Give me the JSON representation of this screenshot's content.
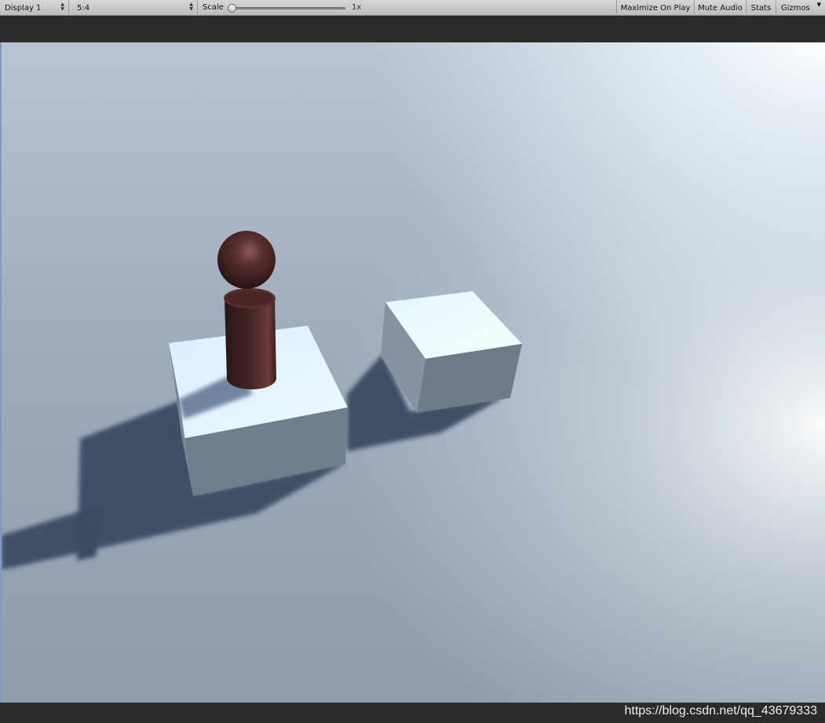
{
  "toolbar": {
    "display_label": "Display 1",
    "aspect_label": "5:4",
    "scale_label": "Scale",
    "scale_value": "1x",
    "maximize_label": "Maximize On Play",
    "mute_label": "Mute Audio",
    "stats_label": "Stats",
    "gizmos_label": "Gizmos",
    "dropdown_icon": "up-down-arrows-icon"
  },
  "scene": {
    "sky_color": "#dfeefa",
    "ground_color": "#9aa8b8",
    "shadow_color": "#3f5169",
    "box_top_color": "#e6f6ff",
    "box_front_color": "#6f7d8a",
    "character_color": "#3a1f1f"
  },
  "watermark": "https://blog.csdn.net/qq_43679333"
}
